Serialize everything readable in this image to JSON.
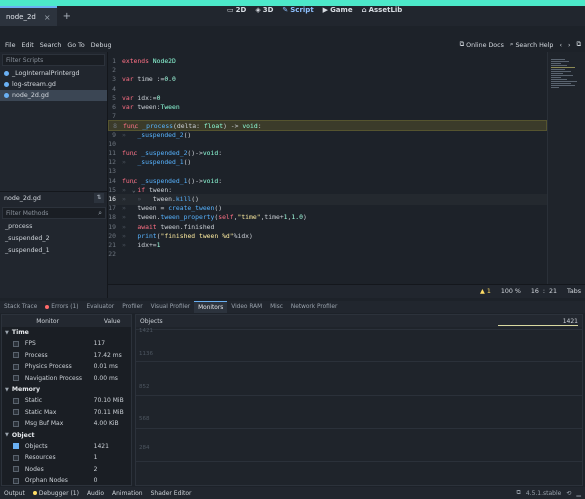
{
  "top_tabs": {
    "active": "node_2d",
    "close": "×",
    "add": "+"
  },
  "main_screens": [
    {
      "icon": "▭",
      "label": "2D"
    },
    {
      "icon": "◈",
      "label": "3D"
    },
    {
      "icon": "✎",
      "label": "Script"
    },
    {
      "icon": "▶",
      "label": "Game"
    },
    {
      "icon": "⌂",
      "label": "AssetLib"
    }
  ],
  "menu": [
    "File",
    "Edit",
    "Search",
    "Go To",
    "Debug"
  ],
  "menu_right": {
    "online_docs": "Online Docs",
    "search_help": "Search Help"
  },
  "script_panel": {
    "filter_placeholder": "Filter Scripts",
    "scripts": [
      "_LogInternalPrintergd",
      "log-stream.gd",
      "node_2d.gd"
    ],
    "current_script": "node_2d.gd",
    "method_filter_placeholder": "Filter Methods",
    "methods": [
      "_process",
      "_suspended_2",
      "_suspended_1"
    ]
  },
  "status": {
    "warnings": "1",
    "zoom": "100 %",
    "line": "16",
    "col": "21",
    "indent": "Tabs"
  },
  "debugger_tabs": [
    "Stack Trace",
    "Errors (1)",
    "Evaluator",
    "Profiler",
    "Visual Profiler",
    "Monitors",
    "Video RAM",
    "Misc",
    "Network Profiler"
  ],
  "monitors": {
    "header_monitor": "Monitor",
    "header_value": "Value",
    "groups": [
      {
        "name": "Time",
        "rows": [
          {
            "name": "FPS",
            "value": "117"
          },
          {
            "name": "Process",
            "value": "17.42 ms"
          },
          {
            "name": "Physics Process",
            "value": "0.01 ms"
          },
          {
            "name": "Navigation Process",
            "value": "0.00 ms"
          }
        ]
      },
      {
        "name": "Memory",
        "rows": [
          {
            "name": "Static",
            "value": "70.10 MiB"
          },
          {
            "name": "Static Max",
            "value": "70.11 MiB"
          },
          {
            "name": "Msg Buf Max",
            "value": "4.00 KiB"
          }
        ]
      },
      {
        "name": "Object",
        "rows": [
          {
            "name": "Objects",
            "value": "1421",
            "checked": true
          },
          {
            "name": "Resources",
            "value": "1"
          },
          {
            "name": "Nodes",
            "value": "2"
          },
          {
            "name": "Orphan Nodes",
            "value": "0"
          }
        ]
      }
    ],
    "graph_title": "Objects",
    "graph_value": "1421",
    "graph_ticks": [
      "1421",
      "1136",
      "852",
      "568",
      "284"
    ]
  },
  "bottom_tabs": [
    "Output",
    "Debugger (1)",
    "Audio",
    "Animation",
    "Shader Editor"
  ],
  "version": "4.5.1.stable"
}
